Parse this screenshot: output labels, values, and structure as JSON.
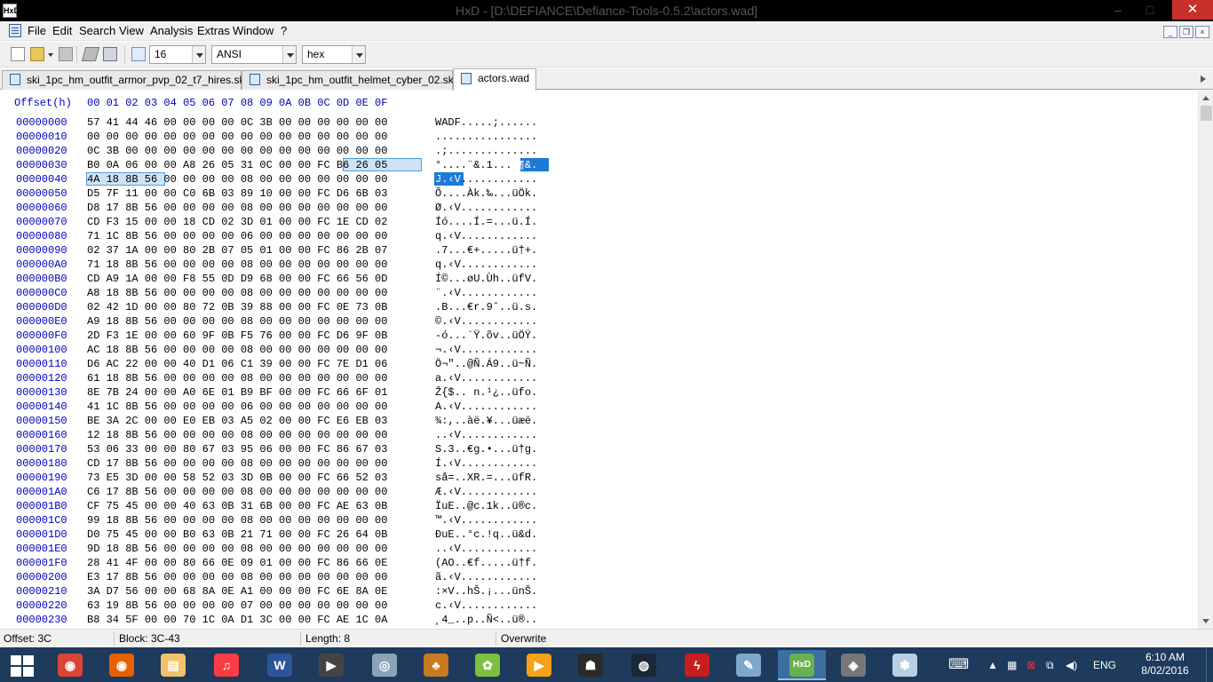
{
  "window": {
    "title": "HxD - [D:\\DEFIANCE\\Defiance-Tools-0.5.2\\actors.wad]",
    "app_icon_text": "HxD",
    "minimize": "‒",
    "maximize": "□",
    "close": "✕"
  },
  "menu": {
    "items": [
      "File",
      "Edit",
      "Search",
      "View",
      "Analysis",
      "Extras",
      "Window",
      "?"
    ]
  },
  "toolbar": {
    "bytes_per_row": "16",
    "charset": "ANSI",
    "offset_base": "hex"
  },
  "tabs": [
    {
      "label": "ski_1pc_hm_outfit_armor_pvp_02_t7_hires.ski",
      "active": false
    },
    {
      "label": "ski_1pc_hm_outfit_helmet_cyber_02.ski",
      "active": false
    },
    {
      "label": "actors.wad",
      "active": true
    }
  ],
  "editor": {
    "offset_header": "Offset(h)",
    "column_header": "00 01 02 03 04 05 06 07 08 09 0A 0B 0C 0D 0E 0F",
    "rows": [
      {
        "off": "00000000",
        "hex": "57 41 44 46 00 00 00 00 0C 3B 00 00 00 00 00 00",
        "ascii": "WADF.....;......"
      },
      {
        "off": "00000010",
        "hex": "00 00 00 00 00 00 00 00 00 00 00 00 00 00 00 00",
        "ascii": "................"
      },
      {
        "off": "00000020",
        "hex": "0C 3B 00 00 00 00 00 00 00 00 00 00 00 00 00 00",
        "ascii": ".;.............."
      },
      {
        "off": "00000030",
        "hex": "B0 0A 06 00 00 A8 26 05 31 0C 00 00 FC B6 26 05",
        "ascii_head": "°....¨&.1...",
        "ascii_tail": "ü¶&."
      },
      {
        "off": "00000040",
        "hex": "4A 18 8B 56 00 00 00 00 08 00 00 00 00 00 00 00",
        "ascii_head": "J.‹V",
        "ascii_tail": "............"
      },
      {
        "off": "00000050",
        "hex": "D5 7F 11 00 00 C0 6B 03 89 10 00 00 FC D6 6B 03",
        "ascii": "Õ....Àk.‰...üÖk."
      },
      {
        "off": "00000060",
        "hex": "D8 17 8B 56 00 00 00 00 08 00 00 00 00 00 00 00",
        "ascii": "Ø.‹V............"
      },
      {
        "off": "00000070",
        "hex": "CD F3 15 00 00 18 CD 02 3D 01 00 00 FC 1E CD 02",
        "ascii": "Íó....Í.=...ü.Í."
      },
      {
        "off": "00000080",
        "hex": "71 1C 8B 56 00 00 00 00 06 00 00 00 00 00 00 00",
        "ascii": "q.‹V............"
      },
      {
        "off": "00000090",
        "hex": "02 37 1A 00 00 80 2B 07 05 01 00 00 FC 86 2B 07",
        "ascii": ".7...€+.....ü†+."
      },
      {
        "off": "000000A0",
        "hex": "71 18 8B 56 00 00 00 00 08 00 00 00 00 00 00 00",
        "ascii": "q.‹V............"
      },
      {
        "off": "000000B0",
        "hex": "CD A9 1A 00 00 F8 55 0D D9 68 00 00 FC 66 56 0D",
        "ascii": "Í©...øU.Ùh..üfV."
      },
      {
        "off": "000000C0",
        "hex": "A8 18 8B 56 00 00 00 00 08 00 00 00 00 00 00 00",
        "ascii": "¨.‹V............"
      },
      {
        "off": "000000D0",
        "hex": "02 42 1D 00 00 80 72 0B 39 88 00 00 FC 0E 73 0B",
        "ascii": ".B...€r.9ˆ..ü.s."
      },
      {
        "off": "000000E0",
        "hex": "A9 18 8B 56 00 00 00 00 08 00 00 00 00 00 00 00",
        "ascii": "©.‹V............"
      },
      {
        "off": "000000F0",
        "hex": "2D F3 1E 00 00 60 9F 0B F5 76 00 00 FC D6 9F 0B",
        "ascii": "-ó...`Ÿ.õv..üÖŸ."
      },
      {
        "off": "00000100",
        "hex": "AC 18 8B 56 00 00 00 00 08 00 00 00 00 00 00 00",
        "ascii": "¬.‹V............"
      },
      {
        "off": "00000110",
        "hex": "D6 AC 22 00 00 40 D1 06 C1 39 00 00 FC 7E D1 06",
        "ascii": "Ö¬\"..@Ñ.Á9..ü~Ñ."
      },
      {
        "off": "00000120",
        "hex": "61 18 8B 56 00 00 00 00 08 00 00 00 00 00 00 00",
        "ascii": "a.‹V............"
      },
      {
        "off": "00000130",
        "hex": "8E 7B 24 00 00 A0 6E 01 B9 BF 00 00 FC 66 6F 01",
        "ascii": "Ž{$.. n.¹¿..üfo."
      },
      {
        "off": "00000140",
        "hex": "41 1C 8B 56 00 00 00 00 06 00 00 00 00 00 00 00",
        "ascii": "A.‹V............"
      },
      {
        "off": "00000150",
        "hex": "BE 3A 2C 00 00 E0 EB 03 A5 02 00 00 FC E6 EB 03",
        "ascii": "¾:,..àë.¥...üæë."
      },
      {
        "off": "00000160",
        "hex": "12 18 8B 56 00 00 00 00 08 00 00 00 00 00 00 00",
        "ascii": "..‹V............"
      },
      {
        "off": "00000170",
        "hex": "53 06 33 00 00 80 67 03 95 06 00 00 FC 86 67 03",
        "ascii": "S.3..€g.•...ü†g."
      },
      {
        "off": "00000180",
        "hex": "CD 17 8B 56 00 00 00 00 08 00 00 00 00 00 00 00",
        "ascii": "Í.‹V............"
      },
      {
        "off": "00000190",
        "hex": "73 E5 3D 00 00 58 52 03 3D 0B 00 00 FC 66 52 03",
        "ascii": "så=..XR.=...üfR."
      },
      {
        "off": "000001A0",
        "hex": "C6 17 8B 56 00 00 00 00 08 00 00 00 00 00 00 00",
        "ascii": "Æ.‹V............"
      },
      {
        "off": "000001B0",
        "hex": "CF 75 45 00 00 40 63 0B 31 6B 00 00 FC AE 63 0B",
        "ascii": "ÏuE..@c.1k..ü®c."
      },
      {
        "off": "000001C0",
        "hex": "99 18 8B 56 00 00 00 00 08 00 00 00 00 00 00 00",
        "ascii": "™.‹V............"
      },
      {
        "off": "000001D0",
        "hex": "D0 75 45 00 00 B0 63 0B 21 71 00 00 FC 26 64 0B",
        "ascii": "ÐuE..°c.!q..ü&d."
      },
      {
        "off": "000001E0",
        "hex": "9D 18 8B 56 00 00 00 00 08 00 00 00 00 00 00 00",
        "ascii": "..‹V............"
      },
      {
        "off": "000001F0",
        "hex": "28 41 4F 00 00 80 66 0E 09 01 00 00 FC 86 66 0E",
        "ascii": "(AO..€f.....ü†f."
      },
      {
        "off": "00000200",
        "hex": "E3 17 8B 56 00 00 00 00 08 00 00 00 00 00 00 00",
        "ascii": "ã.‹V............"
      },
      {
        "off": "00000210",
        "hex": "3A D7 56 00 00 68 8A 0E A1 00 00 00 FC 6E 8A 0E",
        "ascii": ":×V..hŠ.¡...ünŠ."
      },
      {
        "off": "00000220",
        "hex": "63 19 8B 56 00 00 00 00 07 00 00 00 00 00 00 00",
        "ascii": "c.‹V............"
      },
      {
        "off": "00000230",
        "hex": "B8 34 5F 00 00 70 1C 0A D1 3C 00 00 FC AE 1C 0A",
        "ascii": "¸4_..p..Ñ<..ü®.."
      }
    ]
  },
  "status": {
    "offset": "Offset: 3C",
    "block": "Block: 3C-43",
    "length": "Length: 8",
    "mode": "Overwrite"
  },
  "taskbar": {
    "apps": [
      {
        "name": "chrome-icon",
        "color": "#db4437",
        "glyph": "◉"
      },
      {
        "name": "firefox-icon",
        "color": "#e66000",
        "glyph": "◉"
      },
      {
        "name": "file-explorer-icon",
        "color": "#f0c36a",
        "glyph": "▤"
      },
      {
        "name": "itunes-icon",
        "color": "#fc3c44",
        "glyph": "♫"
      },
      {
        "name": "word-icon",
        "color": "#2b579a",
        "glyph": "W"
      },
      {
        "name": "movie-maker-icon",
        "color": "#444444",
        "glyph": "▶"
      },
      {
        "name": "camera-icon",
        "color": "#8aa3b8",
        "glyph": "◎"
      },
      {
        "name": "paw-icon",
        "color": "#c77a1e",
        "glyph": "♣"
      },
      {
        "name": "game-icon-pineapple",
        "color": "#7fbf3f",
        "glyph": "✿"
      },
      {
        "name": "media-player-icon",
        "color": "#f7a21b",
        "glyph": "▶"
      },
      {
        "name": "game-icon-dragon",
        "color": "#2a2a2a",
        "glyph": "☗"
      },
      {
        "name": "steam-icon",
        "color": "#1b2838",
        "glyph": "◍"
      },
      {
        "name": "game-icon-red",
        "color": "#c81e1e",
        "glyph": "ϟ"
      },
      {
        "name": "notepad-icon",
        "color": "#7fa7c9",
        "glyph": "✎"
      },
      {
        "name": "hxd-icon",
        "color": "#6ab04c",
        "glyph": "HxD"
      },
      {
        "name": "game-icon-badge",
        "color": "#777777",
        "glyph": "◈"
      },
      {
        "name": "paint-icon",
        "color": "#b8cfe6",
        "glyph": "✽"
      }
    ],
    "language": "ENG",
    "time": "6:10 AM",
    "date": "8/02/2016"
  }
}
